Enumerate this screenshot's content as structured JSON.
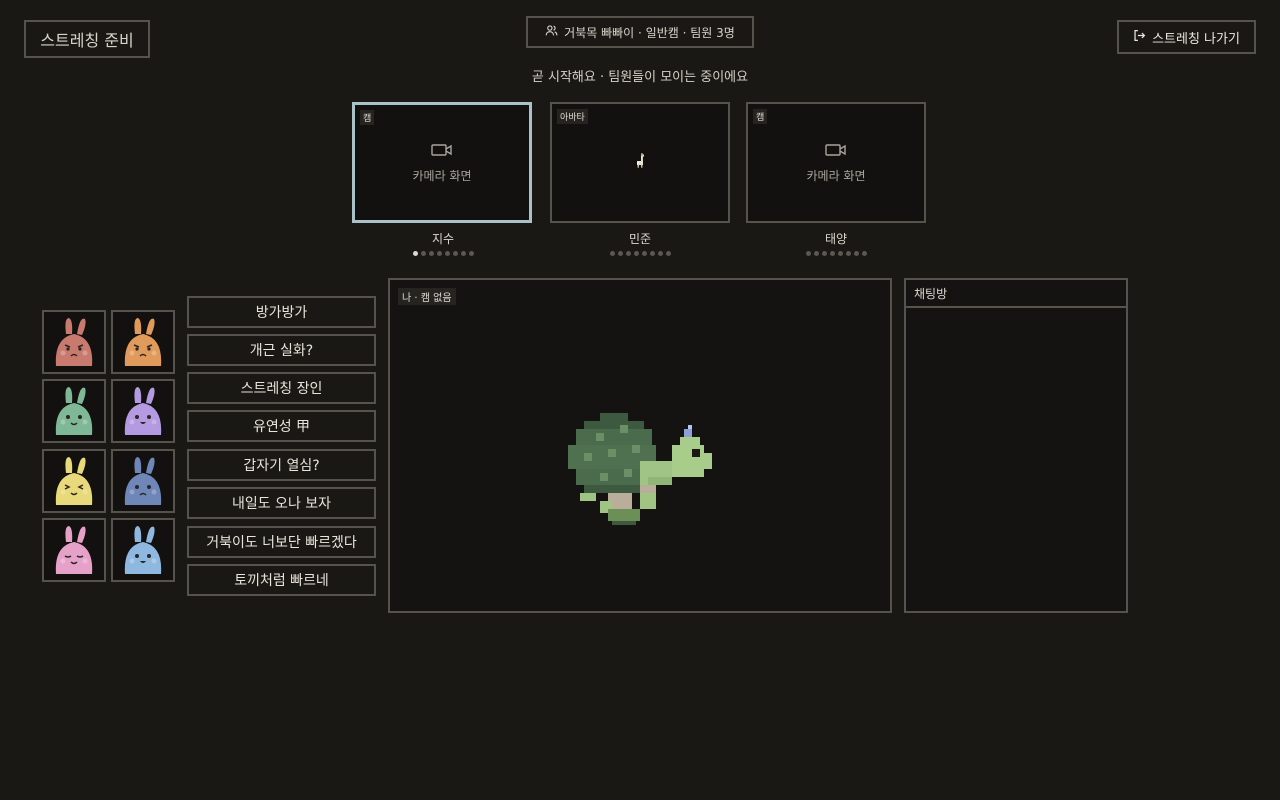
{
  "header": {
    "title": "스트레칭 준비",
    "team_info": "거북목 빠빠이 · 일반캠 · 팀원 3명",
    "exit_label": "스트레칭 나가기"
  },
  "status": "곧 시작해요 · 팀원들이 모이는 중이에요",
  "participants": [
    {
      "tag": "캠",
      "placeholder": "카메라 화면",
      "name": "지수"
    },
    {
      "tag": "아바타",
      "name": "민준"
    },
    {
      "tag": "캠",
      "placeholder": "카메라 화면",
      "name": "태양"
    }
  ],
  "messages": [
    "방가방가",
    "개근 실화?",
    "스트레칭 장인",
    "유연성 甲",
    "갑자기 열심?",
    "내일도 오나 보자",
    "거북이도 너보단 빠르겠다",
    "토끼처럼 빠르네"
  ],
  "main_view": {
    "tag": "나 · 캠 없음"
  },
  "chat": {
    "title": "채팅방"
  },
  "colors": {
    "background": "#1a1814",
    "border": "#56534d",
    "active_border": "#a9c2c8",
    "avatars": [
      "#c97a6e",
      "#e09a5c",
      "#7fb897",
      "#b49ae0",
      "#e8d97a",
      "#6f86b8",
      "#e6a1c8",
      "#8fb8e0"
    ]
  }
}
